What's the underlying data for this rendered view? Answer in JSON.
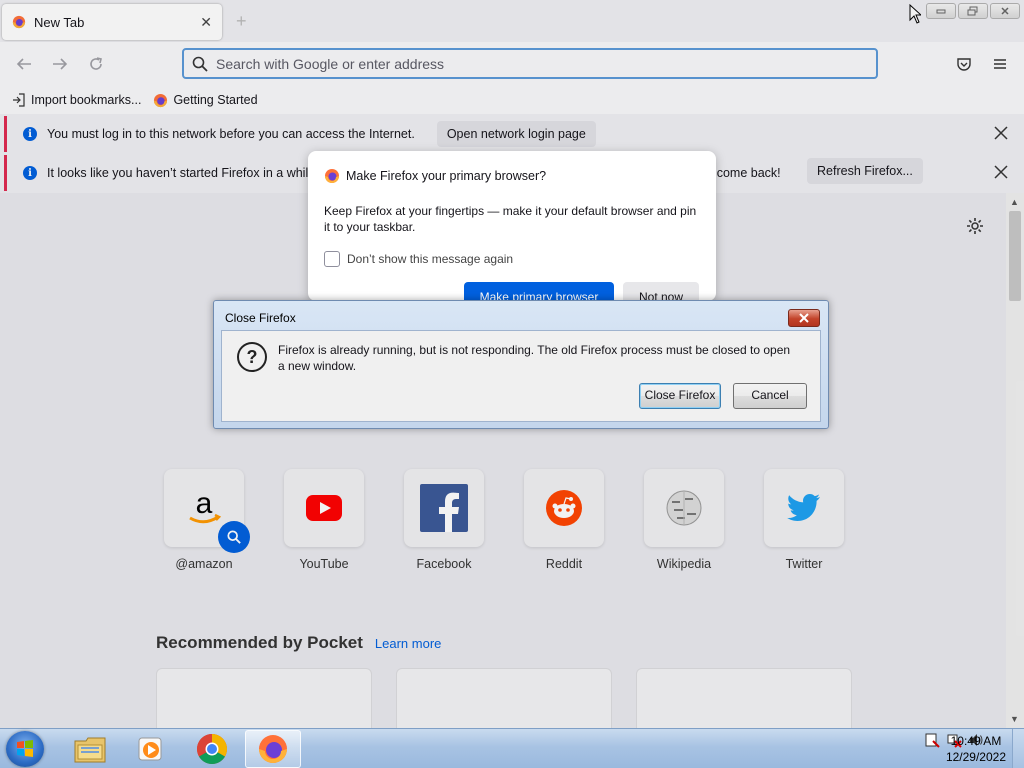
{
  "browser": {
    "tab_title": "New Tab",
    "tab_close": "✕",
    "new_tab": "+",
    "address_placeholder": "Search with Google or enter address"
  },
  "bookmarks": [
    {
      "label": "Import bookmarks...",
      "icon": "import-icon"
    },
    {
      "label": "Getting Started",
      "icon": "firefox-icon"
    }
  ],
  "notifications": [
    {
      "text": "You must log in to this network before you can access the Internet.",
      "button": "Open network login page"
    },
    {
      "text": "It looks like you haven’t started Firefox in a while. D",
      "trailing": "elcome back!",
      "button": "Refresh Firefox..."
    }
  ],
  "top_sites": [
    {
      "label": "@amazon",
      "icon": "amazon-icon"
    },
    {
      "label": "YouTube",
      "icon": "youtube-icon"
    },
    {
      "label": "Facebook",
      "icon": "facebook-icon"
    },
    {
      "label": "Reddit",
      "icon": "reddit-icon"
    },
    {
      "label": "Wikipedia",
      "icon": "wikipedia-icon"
    },
    {
      "label": "Twitter",
      "icon": "twitter-icon"
    }
  ],
  "pocket": {
    "heading": "Recommended by Pocket",
    "learn_more": "Learn more"
  },
  "primary_dialog": {
    "title": "Make Firefox your primary browser?",
    "body": "Keep Firefox at your fingertips — make it your default browser and pin it to your taskbar.",
    "checkbox_label": "Don’t show this message again",
    "primary_button": "Make primary browser",
    "secondary_button": "Not now"
  },
  "close_dialog": {
    "title": "Close Firefox",
    "message": "Firefox is already running, but is not responding. The old Firefox process must be closed to open a new window.",
    "confirm_button": "Close Firefox",
    "cancel_button": "Cancel"
  },
  "taskbar": {
    "time": "10:49 AM",
    "date": "12/29/2022",
    "apps": [
      "file-explorer-icon",
      "media-player-icon",
      "chrome-icon",
      "firefox-icon"
    ]
  },
  "colors": {
    "accent_blue": "#0060df",
    "notification_border": "#e02950",
    "taskbar": "#a8c3e3"
  }
}
